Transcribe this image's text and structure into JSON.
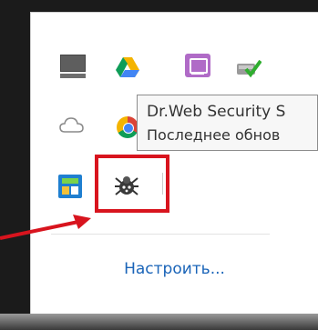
{
  "tray": {
    "icons": [
      {
        "name": "display-icon"
      },
      {
        "name": "google-drive-icon"
      },
      {
        "name": "purple-window-icon"
      },
      {
        "name": "checkmark-drive-icon"
      },
      {
        "name": "cloud-icon"
      },
      {
        "name": "chrome-icon"
      },
      {
        "name": "blue-grid-app-icon"
      },
      {
        "name": "drweb-spider-icon"
      }
    ],
    "highlight_color": "#d8141e",
    "customize_label": "Настроить..."
  },
  "tooltip": {
    "title": "Dr.Web Security S",
    "subtitle": "Последнее обнов"
  },
  "colors": {
    "link": "#1a64b8",
    "annotation_red": "#d8141e"
  }
}
